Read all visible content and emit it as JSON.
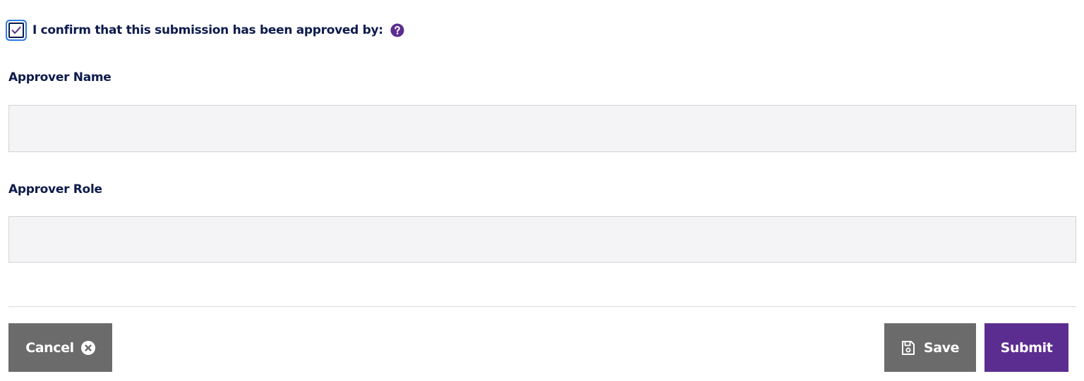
{
  "confirmation": {
    "checked": true,
    "label": "I confirm that this submission has been approved by:",
    "help_icon": "question-circle-icon"
  },
  "approver_name": {
    "label": "Approver Name",
    "value": "",
    "placeholder": ""
  },
  "approver_role": {
    "label": "Approver Role",
    "value": "",
    "placeholder": ""
  },
  "actions": {
    "cancel_label": "Cancel",
    "cancel_icon": "close-circle-icon",
    "save_label": "Save",
    "save_icon": "floppy-disk-icon",
    "submit_label": "Submit"
  },
  "colors": {
    "text_primary": "#0d1b4c",
    "accent_purple": "#5c2d91",
    "button_gray": "#6b6b6b",
    "input_background": "#f4f4f6",
    "focus_ring": "#2f7ae5"
  }
}
